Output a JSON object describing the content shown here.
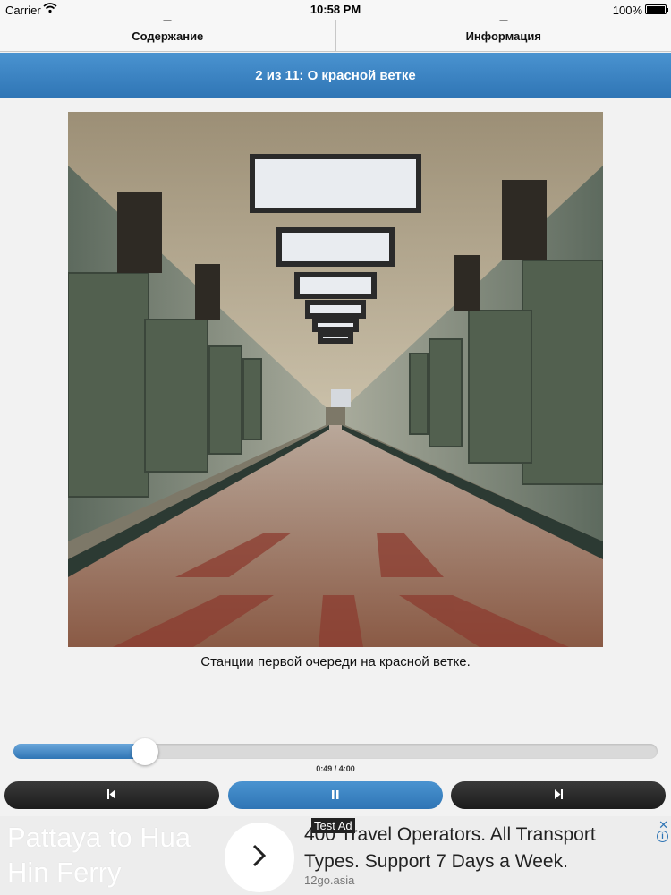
{
  "status_bar": {
    "carrier": "Carrier",
    "time": "10:58 PM",
    "battery": "100%"
  },
  "tabs": [
    {
      "label": "Содержание",
      "icon": "menu-icon"
    },
    {
      "label": "Информация",
      "icon": "info-icon"
    }
  ],
  "header": {
    "title": "2 из 11: О красной ветке"
  },
  "content": {
    "image_alt": "metro-station-hall",
    "caption": "Станции первой очереди на красной ветке."
  },
  "player": {
    "timecode": "0:49 / 4:00",
    "progress": 0.204,
    "prev_icon": "skip-previous-icon",
    "pause_icon": "pause-icon",
    "next_icon": "skip-next-icon"
  },
  "ad": {
    "title": "Pattaya to Hua Hin Ferry",
    "badge": "Test Ad",
    "headline": "400 Travel Operators. All Transport Types. Support 7 Days a Week.",
    "domain": "12go.asia",
    "close": "✕",
    "info": "i"
  },
  "colors": {
    "accent": "#2f75b5",
    "dark_button": "#1c1c1c"
  }
}
